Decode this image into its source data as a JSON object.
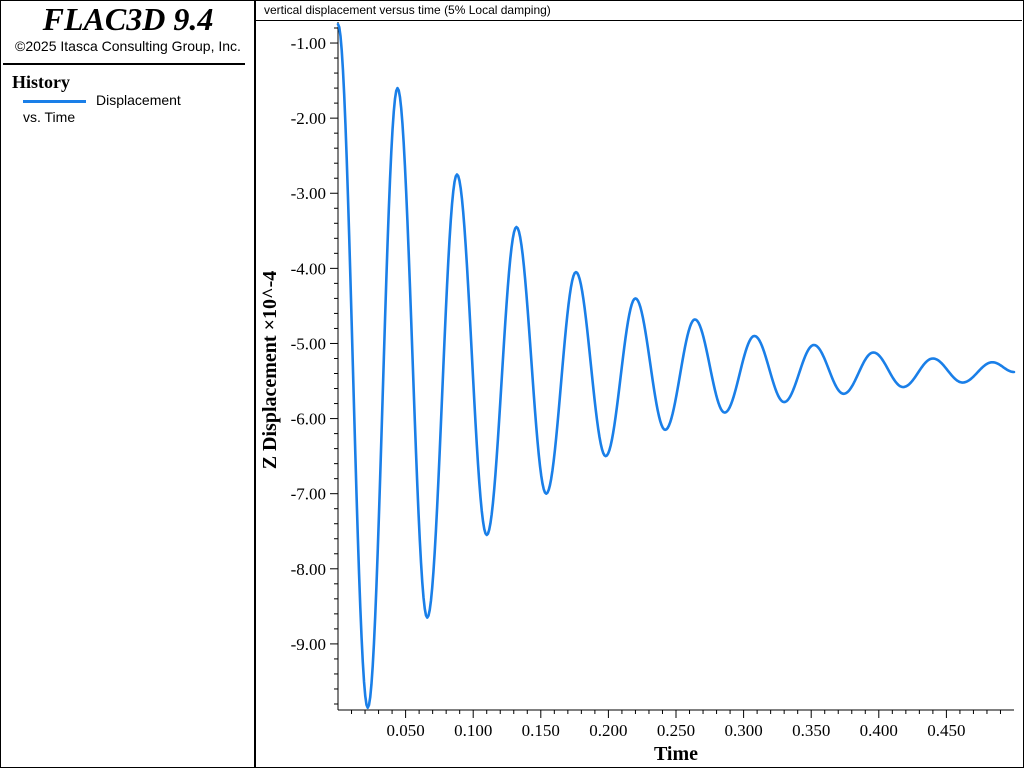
{
  "app": {
    "title": "FLAC3D 9.4",
    "copyright": "©2025 Itasca Consulting Group, Inc."
  },
  "legend": {
    "heading": "History",
    "line1": "Displacement",
    "line2": "vs. Time",
    "color": "#1a7fe8"
  },
  "plot": {
    "title": "vertical displacement versus time (5% Local damping)"
  },
  "chart_data": {
    "type": "line",
    "title": "vertical displacement versus time (5% Local damping)",
    "xlabel": "Time",
    "ylabel": "Z Displacement ×10^-4",
    "xlim": [
      0.0,
      0.5
    ],
    "ylim": [
      -9.88,
      -0.72
    ],
    "x_ticks": [
      "0.050",
      "0.100",
      "0.150",
      "0.200",
      "0.250",
      "0.300",
      "0.350",
      "0.400",
      "0.450"
    ],
    "y_ticks": [
      "-1.00",
      "-2.00",
      "-3.00",
      "-4.00",
      "-5.00",
      "-6.00",
      "-7.00",
      "-8.00",
      "-9.00"
    ],
    "grid": false,
    "series": [
      {
        "color": "#1a7fe8",
        "x": [
          0.0,
          0.022,
          0.044,
          0.066,
          0.088,
          0.11,
          0.132,
          0.154,
          0.176,
          0.198,
          0.22,
          0.242,
          0.264,
          0.286,
          0.308,
          0.33,
          0.352,
          0.374,
          0.396,
          0.418,
          0.44,
          0.462,
          0.484,
          0.5
        ],
        "values": [
          -0.75,
          -9.85,
          -1.6,
          -8.65,
          -2.75,
          -7.55,
          -3.45,
          -7.0,
          -4.05,
          -6.5,
          -4.4,
          -6.15,
          -4.68,
          -5.92,
          -4.9,
          -5.78,
          -5.02,
          -5.67,
          -5.12,
          -5.58,
          -5.2,
          -5.52,
          -5.25,
          -5.38
        ]
      }
    ]
  }
}
